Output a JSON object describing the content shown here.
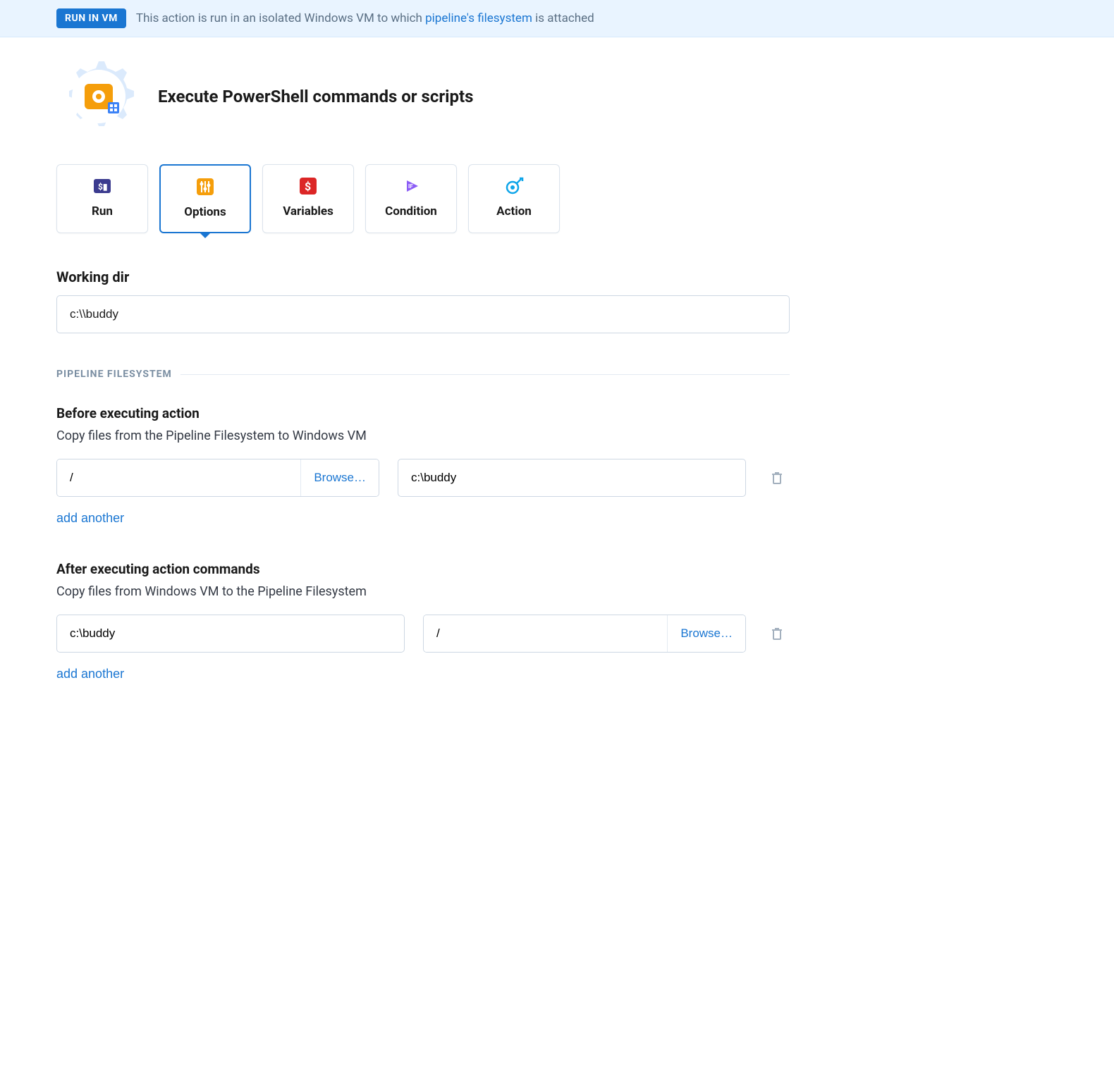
{
  "banner": {
    "badge": "RUN IN VM",
    "text_before": "This action is run in an isolated Windows VM to which ",
    "link": "pipeline's filesystem",
    "text_after": " is attached"
  },
  "page_title": "Execute PowerShell commands or scripts",
  "tabs": [
    {
      "id": "run",
      "label": "Run",
      "active": false
    },
    {
      "id": "options",
      "label": "Options",
      "active": true
    },
    {
      "id": "variables",
      "label": "Variables",
      "active": false
    },
    {
      "id": "condition",
      "label": "Condition",
      "active": false
    },
    {
      "id": "action",
      "label": "Action",
      "active": false
    }
  ],
  "working_dir": {
    "label": "Working dir",
    "value": "c:\\\\buddy"
  },
  "section_title": "PIPELINE FILESYSTEM",
  "before": {
    "heading": "Before executing action",
    "desc": "Copy files from the Pipeline Filesystem to Windows VM",
    "source": "/",
    "browse": "Browse…",
    "dest": "c:\\buddy",
    "add": "add another"
  },
  "after": {
    "heading": "After executing action commands",
    "desc": "Copy files from Windows VM to the Pipeline Filesystem",
    "source": "c:\\buddy",
    "dest": "/",
    "browse": "Browse…",
    "add": "add another"
  }
}
